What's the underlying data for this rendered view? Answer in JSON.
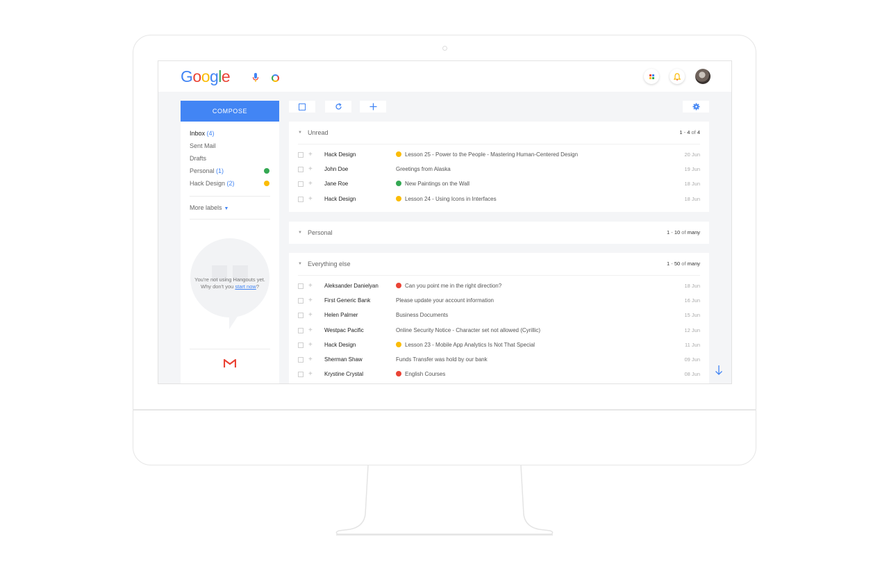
{
  "colors": {
    "accent": "#4285f4",
    "personal": "#34a853",
    "hack_design": "#fbbc05",
    "red_tag": "#ea4335"
  },
  "header": {
    "logo_letters": [
      "G",
      "o",
      "o",
      "g",
      "l",
      "e"
    ],
    "icons": [
      "mic-icon",
      "assistant-icon",
      "apps-icon",
      "bell-icon",
      "avatar"
    ]
  },
  "sidebar": {
    "compose_label": "COMPOSE",
    "items": [
      {
        "label": "Inbox",
        "count": "(4)",
        "dot": ""
      },
      {
        "label": "Sent Mail",
        "count": "",
        "dot": ""
      },
      {
        "label": "Drafts",
        "count": "",
        "dot": ""
      },
      {
        "label": "Personal",
        "count": "(1)",
        "dot": "#34a853"
      },
      {
        "label": "Hack Design",
        "count": "(2)",
        "dot": "#fbbc05"
      }
    ],
    "more_labels": "More labels",
    "hangouts": {
      "line1": "You're not using Hangouts yet.",
      "line2_prefix": "Why don't you ",
      "line2_link": "start now",
      "line2_suffix": "?"
    }
  },
  "toolbar": {
    "icons": [
      "select-checkbox-icon",
      "refresh-icon",
      "add-icon",
      "settings-gear-icon"
    ]
  },
  "sections": {
    "unread": {
      "title": "Unread",
      "range_start": "1",
      "range_sep": " - ",
      "range_end": "4",
      "range_of": " of ",
      "range_total": "4",
      "rows": [
        {
          "sender": "Hack Design",
          "subject": "Lesson 25 - Power to the People - Mastering Human-Centered Design",
          "dot": "#fbbc05",
          "date": "20 Jun"
        },
        {
          "sender": "John Doe",
          "subject": "Greetings from Alaska",
          "dot": "",
          "date": "19 Jun"
        },
        {
          "sender": "Jane Roe",
          "subject": "New Paintings on the Wall",
          "dot": "#34a853",
          "date": "18 Jun"
        },
        {
          "sender": "Hack Design",
          "subject": "Lesson 24 - Using Icons in Interfaces",
          "dot": "#fbbc05",
          "date": "18 Jun"
        }
      ]
    },
    "personal": {
      "title": "Personal",
      "range_start": "1",
      "range_sep": " - ",
      "range_end": "10",
      "range_of": " of ",
      "range_total": "many"
    },
    "everything_else": {
      "title": "Everything else",
      "range_start": "1",
      "range_sep": " - ",
      "range_end": "50",
      "range_of": " of ",
      "range_total": "many",
      "rows": [
        {
          "sender": "Aleksander Danielyan",
          "subject": "Can you point me in the right direction?",
          "dot": "#ea4335",
          "date": "18 Jun"
        },
        {
          "sender": "First Generic Bank",
          "subject": "Please update your account information",
          "dot": "",
          "date": "16 Jun"
        },
        {
          "sender": "Helen Palmer",
          "subject": "Business Documents",
          "dot": "",
          "date": "15 Jun"
        },
        {
          "sender": "Westpac Pacific",
          "subject": "Online Security Notice - Character set not allowed (Cyrillic)",
          "dot": "",
          "date": "12 Jun"
        },
        {
          "sender": "Hack Design",
          "subject": "Lesson 23 - Mobile App Analytics Is Not That Special",
          "dot": "#fbbc05",
          "date": "11 Jun"
        },
        {
          "sender": "Sherman Shaw",
          "subject": "Funds Transfer was hold by our bank",
          "dot": "",
          "date": "09 Jun"
        },
        {
          "sender": "Krystine Crystal",
          "subject": "English Courses",
          "dot": "#ea4335",
          "date": "08 Jun"
        }
      ]
    }
  }
}
